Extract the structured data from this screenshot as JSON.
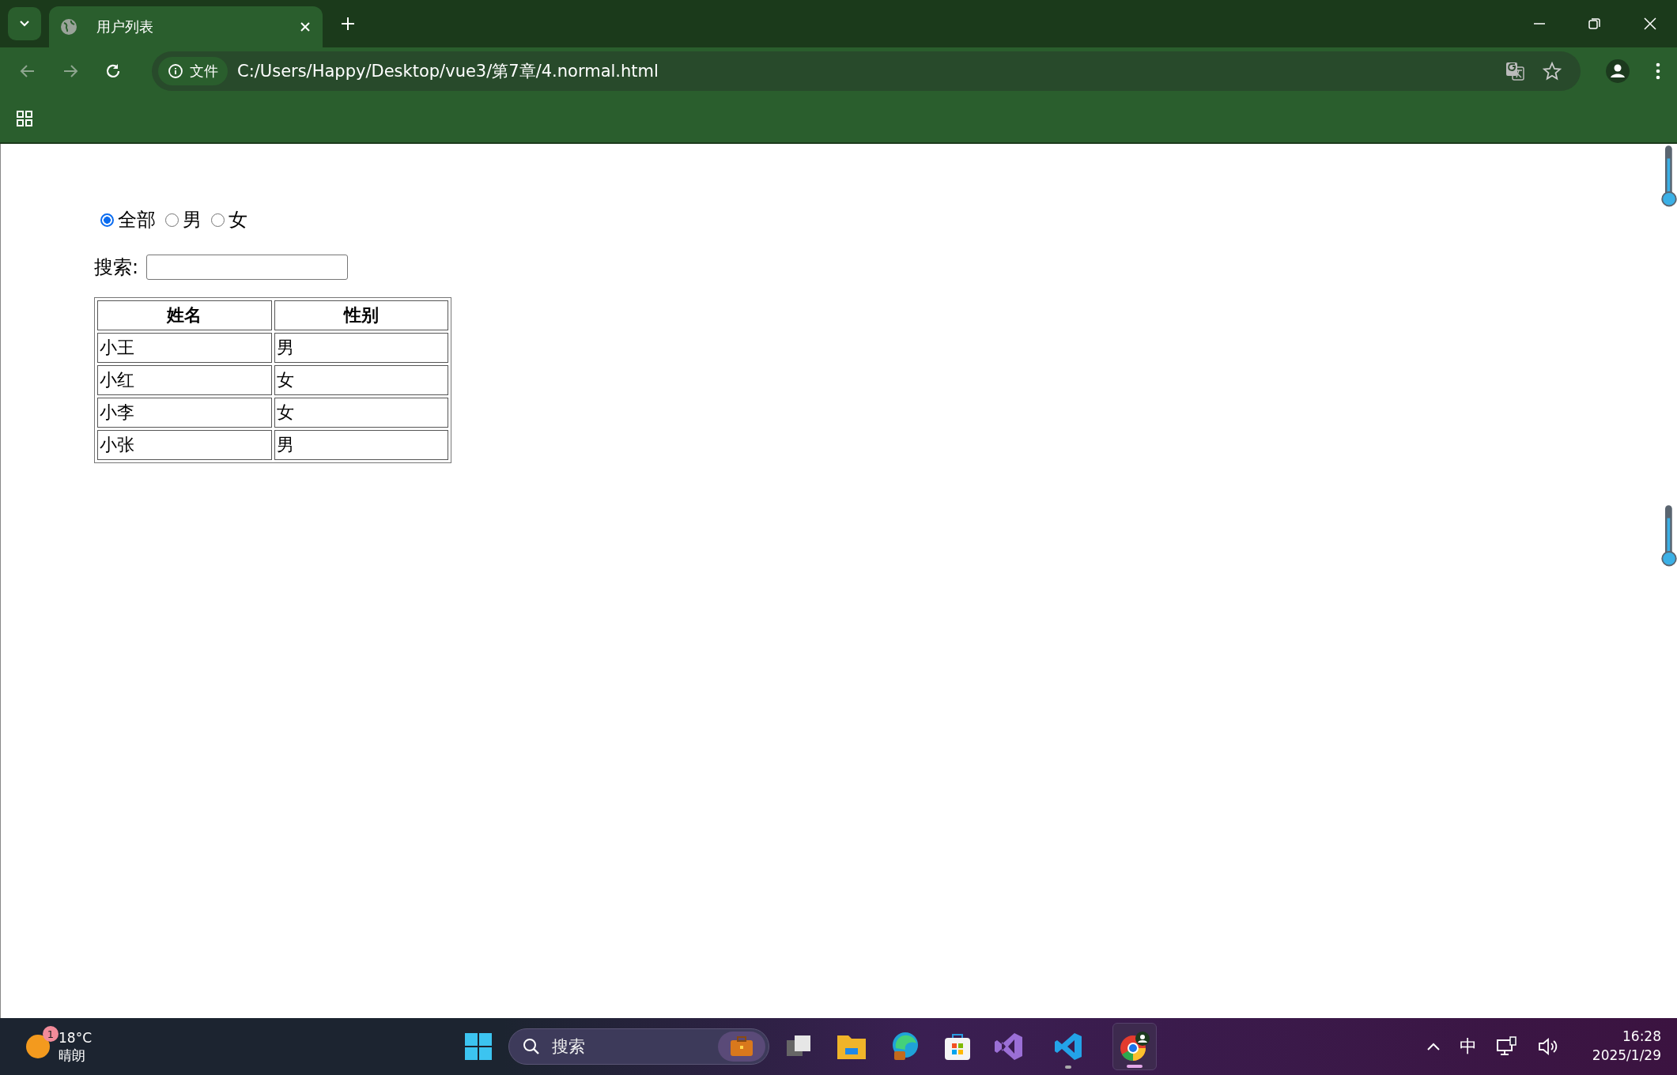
{
  "browser": {
    "tab": {
      "title": "用户列表"
    },
    "address_bar": {
      "security_chip": "文件",
      "url": "C:/Users/Happy/Desktop/vue3/第7章/4.normal.html"
    }
  },
  "page": {
    "filter_radios": [
      {
        "label": "全部",
        "selected": true
      },
      {
        "label": "男",
        "selected": false
      },
      {
        "label": "女",
        "selected": false
      }
    ],
    "search": {
      "label": "搜索:"
    },
    "table": {
      "columns": [
        "姓名",
        "性别"
      ],
      "rows": [
        [
          "小王",
          "男"
        ],
        [
          "小红",
          "女"
        ],
        [
          "小李",
          "女"
        ],
        [
          "小张",
          "男"
        ]
      ]
    }
  },
  "taskbar": {
    "weather": {
      "badge": "1",
      "temperature": "18°C",
      "condition": "晴朗"
    },
    "search": {
      "placeholder": "搜索"
    },
    "input_method": "中",
    "clock": {
      "time": "16:28",
      "date": "2025/1/29"
    }
  }
}
